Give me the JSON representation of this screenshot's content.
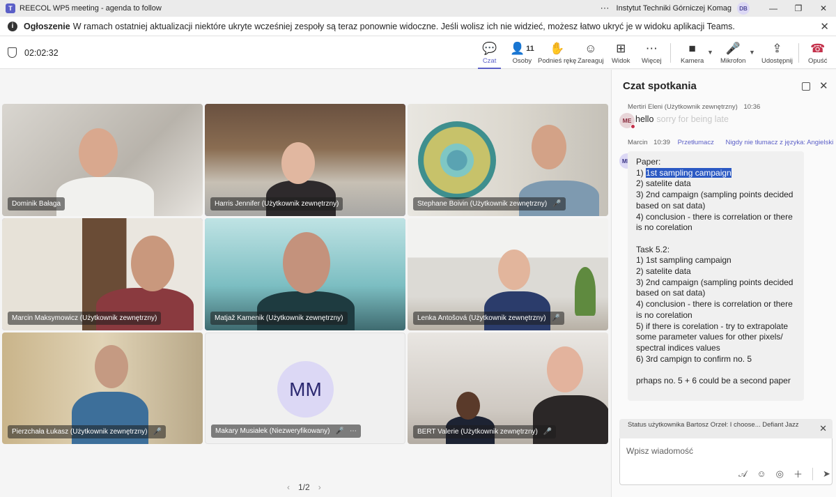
{
  "window": {
    "title": "REECOL WP5 meeting - agenda to follow",
    "org": "Instytut Techniki Górniczej Komag",
    "initials": "DB"
  },
  "banner": {
    "label": "Ogłoszenie",
    "text": "W ramach ostatniej aktualizacji niektóre ukryte wcześniej zespoły są teraz ponownie widoczne. Jeśli wolisz ich nie widzieć, możesz łatwo ukryć je w widoku aplikacji Teams."
  },
  "toolbar": {
    "timer": "02:02:32",
    "chat": "Czat",
    "people": "Osoby",
    "people_count": "11",
    "raise_hand": "Podnieś rękę",
    "react": "Zareaguj",
    "view": "Widok",
    "more": "Więcej",
    "camera": "Kamera",
    "mic": "Mikrofon",
    "share": "Udostępnij",
    "leave": "Opuść"
  },
  "participants": [
    {
      "name": "Dominik Bałaga"
    },
    {
      "name": "Harris Jennifer (Użytkownik zewnętrzny)"
    },
    {
      "name": "Stephane Boivin (Użytkownik zewnętrzny)"
    },
    {
      "name": "Marcin Maksymowicz (Użytkownik zewnętrzny)"
    },
    {
      "name": "Matjaž Kamenik (Użytkownik zewnętrzny)"
    },
    {
      "name": "Lenka Antošová (Użytkownik zewnętrzny)"
    },
    {
      "name": "Pierzchała Łukasz (Użytkownik zewnętrzny)"
    },
    {
      "name": "Makary Musiałek (Niezweryfikowany)",
      "avatar": "MM"
    },
    {
      "name": "BERT Valerie (Użytkownik zewnętrzny)"
    }
  ],
  "pager": {
    "label": "1/2"
  },
  "chat": {
    "header": "Czat spotkania",
    "msg1": {
      "author": "Mertiri Eleni (Użytkownik zewnętrzny)",
      "time": "10:36",
      "avatar": "ME",
      "text": "hello",
      "faded": "sorry for being late"
    },
    "msg2": {
      "author": "Marcin",
      "time": "10:39",
      "translate": "Przetłumacz",
      "never_translate": "Nigdy nie tłumacz z języka: Angielski",
      "avatar": "MM",
      "prefix": "1) ",
      "highlight": "1st sampling campaign",
      "lines": [
        "Paper:",
        "2) satelite data",
        "3) 2nd campaign (sampling points decided based on sat data)",
        "4) conclusion - there is correlation or there is no corelation",
        "",
        "Task 5.2:",
        "1) 1st sampling campaign",
        "2) satelite data",
        "3) 2nd campaign (sampling points decided based on sat data)",
        "4) conclusion - there is correlation or there is no corelation",
        "5) if there is corelation - try to extrapolate some parameter values for other pixels/ spectral indices values",
        "6) 3rd campign to confirm no. 5",
        "",
        "prhaps no. 5 + 6 could be a second paper"
      ]
    },
    "status": "Status użytkownika Bartosz Orzeł: I choose... Defiant Jazz",
    "compose_placeholder": "Wpisz wiadomość"
  }
}
